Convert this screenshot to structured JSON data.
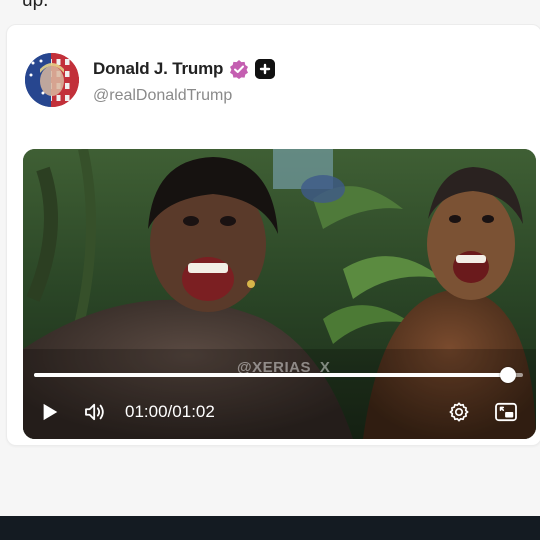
{
  "previous_post": {
    "trailing_text": "up."
  },
  "post": {
    "author": {
      "name": "Donald J. Trump",
      "handle": "@realDonaldTrump",
      "avatar_icon": "avatar-flag-portrait",
      "verified_icon": "verified-badge-icon",
      "platform_icon": "platform-badge-icon",
      "verified_color": "#c45fb1"
    },
    "video": {
      "watermark": "@XERIAS_X",
      "current_time": "01:00",
      "separator": "/",
      "duration": "01:02",
      "progress_fraction": 0.97,
      "controls": {
        "play_icon": "play-icon",
        "volume_icon": "volume-icon",
        "settings_icon": "gear-icon",
        "pip_icon": "picture-in-picture-icon"
      }
    }
  },
  "colors": {
    "page_background": "#f6f6f6",
    "card_background": "#ffffff",
    "name_text": "#222222",
    "handle_text": "#8a8a8a",
    "bottom_bar": "#141b22"
  }
}
